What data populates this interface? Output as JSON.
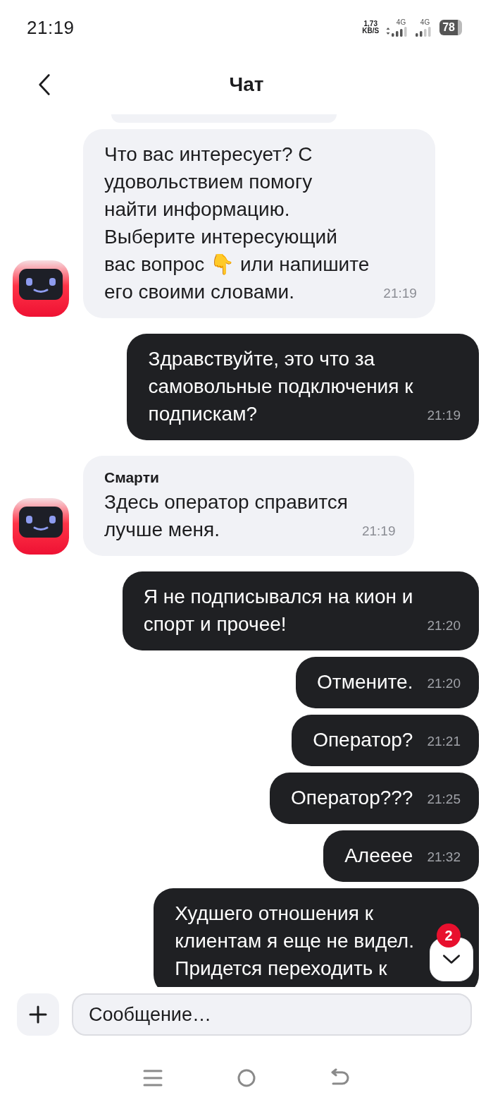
{
  "status_bar": {
    "time": "21:19",
    "speed_value": "1,73",
    "speed_unit": "KB/S",
    "networks": [
      {
        "label": "4G",
        "kind": "data"
      },
      {
        "label": "4G",
        "kind": "plain"
      }
    ],
    "battery": "78"
  },
  "header": {
    "title": "Чат"
  },
  "messages": [
    {
      "kind": "partial"
    },
    {
      "kind": "bot",
      "text": "Что вас интересует? С\nудовольствием помогу\nнайти информацию.\nВыберите интересующий\nвас вопрос 👇 или напишите\nего своими словами.",
      "time": "21:19"
    },
    {
      "kind": "user",
      "text": "Здравствуйте, это что за\nсамовольные подключения к\nподпискам?",
      "time": "21:19"
    },
    {
      "kind": "bot",
      "sender": "Смарти",
      "text": "Здесь оператор справится\nлучше меня.",
      "time": "21:19"
    },
    {
      "kind": "user",
      "text": "Я не подписывался на кион и\nспорт и прочее!",
      "time": "21:20"
    },
    {
      "kind": "user",
      "text": "Отмените.",
      "time": "21:20"
    },
    {
      "kind": "user",
      "text": "Оператор?",
      "time": "21:21"
    },
    {
      "kind": "user",
      "text": "Оператор???",
      "time": "21:25"
    },
    {
      "kind": "user",
      "text": "Алееее",
      "time": "21:32"
    },
    {
      "kind": "user",
      "text": "Худшего отношения к\nклиентам я еще не видел.\nПридется переходить к"
    }
  ],
  "scroll_down": {
    "badge": "2"
  },
  "composer": {
    "placeholder": "Сообщение…"
  }
}
